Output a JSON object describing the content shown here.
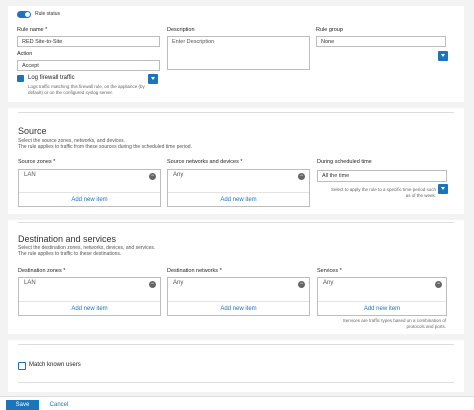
{
  "general": {
    "rule_status_label": "Rule status",
    "rule_name_label": "Rule name *",
    "rule_name_value": "RED Site-to-Site",
    "description_label": "Description",
    "description_placeholder": "Enter Description",
    "rule_group_label": "Rule group",
    "rule_group_value": "None",
    "action_label": "Action",
    "action_value": "Accept",
    "log_label": "Log firewall traffic",
    "log_help": "Logs traffic matching this firewall rule, on the appliance (by default) or on the configured syslog server."
  },
  "source": {
    "title": "Source",
    "desc1": "Select the source zones, networks, and devices.",
    "desc2": "The rule applies to traffic from these sources during the scheduled time period.",
    "zones_label": "Source zones *",
    "zones_value": "LAN",
    "networks_label": "Source networks and devices *",
    "networks_value": "Any",
    "schedule_label": "During scheduled time",
    "schedule_value": "All the time",
    "schedule_help": "Select to apply the rule to a specific time period such as of the week.",
    "add_new": "Add new item"
  },
  "destination": {
    "title": "Destination and services",
    "desc1": "Select the destination zones, networks, devices, and services.",
    "desc2": "The rule applies to traffic to these destinations.",
    "zones_label": "Destination zones *",
    "zones_value": "LAN",
    "networks_label": "Destination networks *",
    "networks_value": "Any",
    "services_label": "Services *",
    "services_value": "Any",
    "services_help": "Services are traffic types based on a combination of protocols and ports.",
    "add_new": "Add new item"
  },
  "identity": {
    "match_users_label": "Match known users"
  },
  "footer": {
    "save_label": "Save",
    "cancel_label": "Cancel"
  }
}
